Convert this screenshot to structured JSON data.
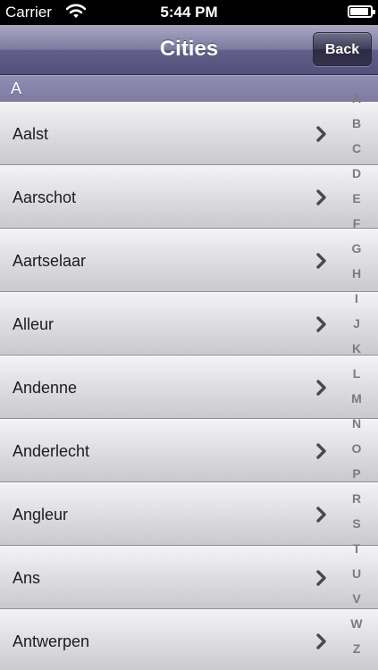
{
  "status_bar": {
    "carrier": "Carrier",
    "time": "5:44 PM",
    "battery_level_percent": 90
  },
  "nav": {
    "title": "Cities",
    "back_label": "Back"
  },
  "section": {
    "header": "A"
  },
  "rows": [
    {
      "label": "Aalst"
    },
    {
      "label": "Aarschot"
    },
    {
      "label": "Aartselaar"
    },
    {
      "label": "Alleur"
    },
    {
      "label": "Andenne"
    },
    {
      "label": "Anderlecht"
    },
    {
      "label": "Angleur"
    },
    {
      "label": "Ans"
    },
    {
      "label": "Antwerpen"
    }
  ],
  "index_letters": [
    "A",
    "B",
    "C",
    "D",
    "E",
    "F",
    "G",
    "H",
    "I",
    "J",
    "K",
    "L",
    "M",
    "N",
    "O",
    "P",
    "R",
    "S",
    "T",
    "U",
    "V",
    "W",
    "Z"
  ],
  "colors": {
    "nav_bar": "#625f8a",
    "section_header": "#8583a9",
    "row_background": "#dcdce0",
    "index_text": "#7c7c80"
  }
}
